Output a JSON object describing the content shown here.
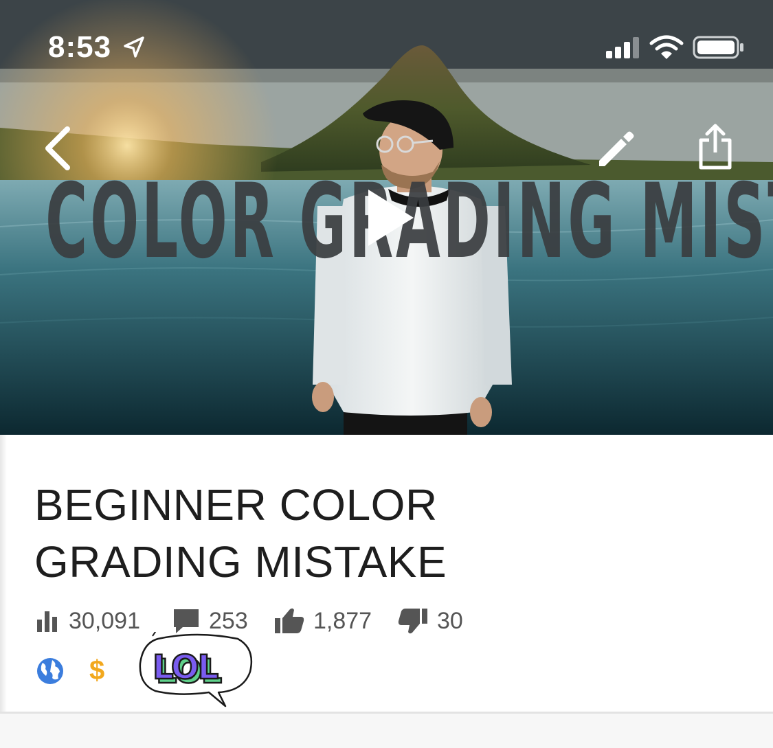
{
  "status_bar": {
    "time": "8:53",
    "icons": [
      "location-arrow-icon",
      "cellular-signal-icon",
      "wifi-icon",
      "battery-icon"
    ]
  },
  "thumbnail": {
    "overlay_title": "COLOR GRADING MISTAKE",
    "icons": [
      "back-chevron-icon",
      "pencil-icon",
      "share-icon",
      "play-icon"
    ]
  },
  "video": {
    "title_line1": "BEGINNER COLOR",
    "title_line2": "GRADING MISTAKE",
    "stats": {
      "views": "30,091",
      "comments": "253",
      "likes": "1,877",
      "dislikes": "30"
    },
    "visibility_icon": "globe-icon",
    "monetization_symbol": "$",
    "sticker_text": "LOL"
  },
  "colors": {
    "monetization": "#f2a81d",
    "globe": "#3b7ddd",
    "sticker_fill": "#7a5cf0",
    "sticker_shadow": "#5fd08a"
  }
}
